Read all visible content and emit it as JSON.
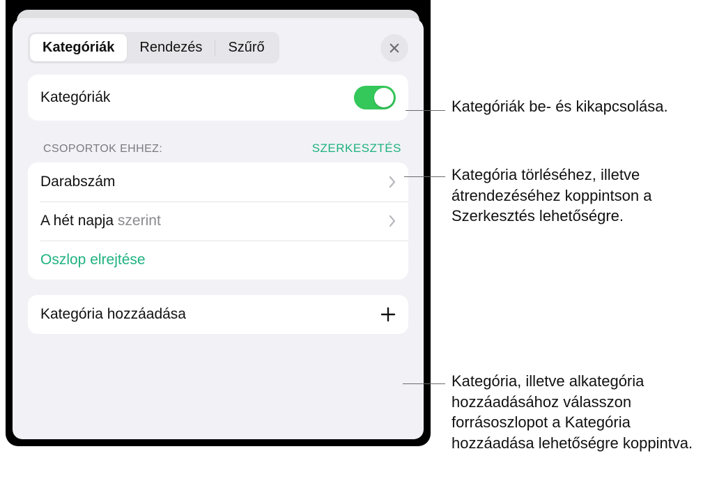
{
  "tabs": {
    "categories": "Kategóriák",
    "sort": "Rendezés",
    "filter": "Szűrő"
  },
  "toggleRow": {
    "label": "Kategóriák"
  },
  "section": {
    "headerLabel": "CSOPORTOK EHHEZ:",
    "editLabel": "SZERKESZTÉS",
    "rows": {
      "count": "Darabszám",
      "weekdayPrefix": "A hét napja",
      "weekdaySuffix": " szerint",
      "hideColumn": "Oszlop elrejtése"
    }
  },
  "addRow": {
    "label": "Kategória hozzáadása"
  },
  "callouts": {
    "toggle": "Kategóriák be- és kikapcsolása.",
    "edit": "Kategória törléséhez, illetve átrendezéséhez koppintson a Szerkesztés lehetőségre.",
    "add": "Kategória, illetve alkategória hozzáadásához válasszon forrásoszlopot a Kategória hozzáadása lehetőségre koppintva."
  }
}
